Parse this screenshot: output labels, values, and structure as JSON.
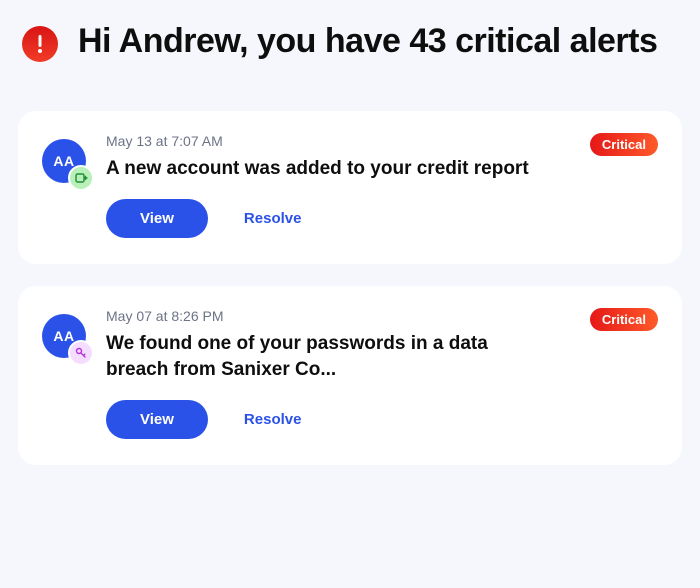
{
  "header": {
    "title": "Hi Andrew, you have 43 critical alerts"
  },
  "alerts": [
    {
      "avatar_initials": "AA",
      "timestamp": "May 13 at 7:07 AM",
      "severity_label": "Critical",
      "title": "A new account was added to your credit report",
      "view_label": "View",
      "resolve_label": "Resolve"
    },
    {
      "avatar_initials": "AA",
      "timestamp": "May 07 at 8:26 PM",
      "severity_label": "Critical",
      "title": "We found one of your passwords in a data breach from Sanixer Co...",
      "view_label": "View",
      "resolve_label": "Resolve"
    }
  ]
}
